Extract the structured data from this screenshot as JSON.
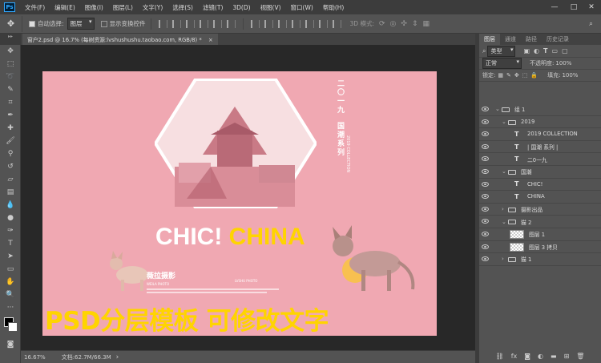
{
  "menubar": {
    "logo": "Ps",
    "items": [
      "文件(F)",
      "编辑(E)",
      "图像(I)",
      "图层(L)",
      "文字(Y)",
      "选择(S)",
      "滤镜(T)",
      "3D(D)",
      "视图(V)",
      "窗口(W)",
      "帮助(H)"
    ],
    "minimize": "—",
    "maximize": "□",
    "close": "✕"
  },
  "options": {
    "tool_icon": "move-icon",
    "auto_select_label": "自动选择:",
    "auto_select_value": "图层",
    "transform_label": "显示变换控件",
    "mode_label": "3D 模式:"
  },
  "document_tab": {
    "title": "窗户2.psd @ 16.7% (每树资源:lvshushushu.taobao.com, RGB/8) *",
    "close": "×"
  },
  "tools": [
    "move",
    "marquee",
    "lasso",
    "quick-select",
    "crop",
    "eyedropper",
    "healing",
    "brush",
    "stamp",
    "history-brush",
    "eraser",
    "gradient",
    "blur",
    "dodge",
    "pen",
    "type",
    "path-select",
    "shape",
    "hand",
    "zoom",
    "more"
  ],
  "artwork": {
    "bg_color": "#f0a8b2",
    "vertical_text_1": "二〇一九",
    "vertical_text_2": "国潮系列",
    "vertical_text_3": "2019 COLLECTION",
    "headline_white": "CHIC!",
    "headline_yellow": "CHINA",
    "brand": "薇拉摄影",
    "brand_sub": "WEILA PHOTO",
    "small_text": "LVSHU PHOTO",
    "overlay": "PSD分层模板 可修改文字",
    "yellow": "#ffd400"
  },
  "status": {
    "zoom": "16.67%",
    "doc_info": "文档:62.7M/66.3M",
    "arrow": "›"
  },
  "panel": {
    "tabs": [
      "图层",
      "通道",
      "路径",
      "历史记录"
    ],
    "kind_label": "类型",
    "blend_mode": "正常",
    "opacity_label": "不透明度:",
    "opacity_value": "100%",
    "lock_label": "锁定:",
    "fill_label": "填充:",
    "fill_value": "100%",
    "layers": [
      {
        "indent": 0,
        "type": "group",
        "open": true,
        "name": "组 1"
      },
      {
        "indent": 1,
        "type": "group",
        "open": true,
        "name": "2019"
      },
      {
        "indent": 2,
        "type": "text",
        "name": "2019  COLLECTION"
      },
      {
        "indent": 2,
        "type": "text",
        "name": "| 国潮  系列 |"
      },
      {
        "indent": 2,
        "type": "text",
        "name": "二0一九"
      },
      {
        "indent": 1,
        "type": "group",
        "open": true,
        "name": "国潮"
      },
      {
        "indent": 2,
        "type": "text",
        "name": "CHIC!"
      },
      {
        "indent": 2,
        "type": "text",
        "name": "CHINA"
      },
      {
        "indent": 1,
        "type": "group",
        "open": false,
        "name": "摄影出品"
      },
      {
        "indent": 1,
        "type": "group",
        "open": true,
        "name": "猫 2"
      },
      {
        "indent": 2,
        "type": "image",
        "name": "图层 1"
      },
      {
        "indent": 2,
        "type": "image",
        "name": "图层 3 拷贝"
      },
      {
        "indent": 1,
        "type": "group",
        "open": false,
        "name": "猫 1"
      }
    ],
    "footer_icons": [
      "link",
      "fx",
      "mask",
      "adjust",
      "group",
      "new",
      "delete"
    ]
  }
}
